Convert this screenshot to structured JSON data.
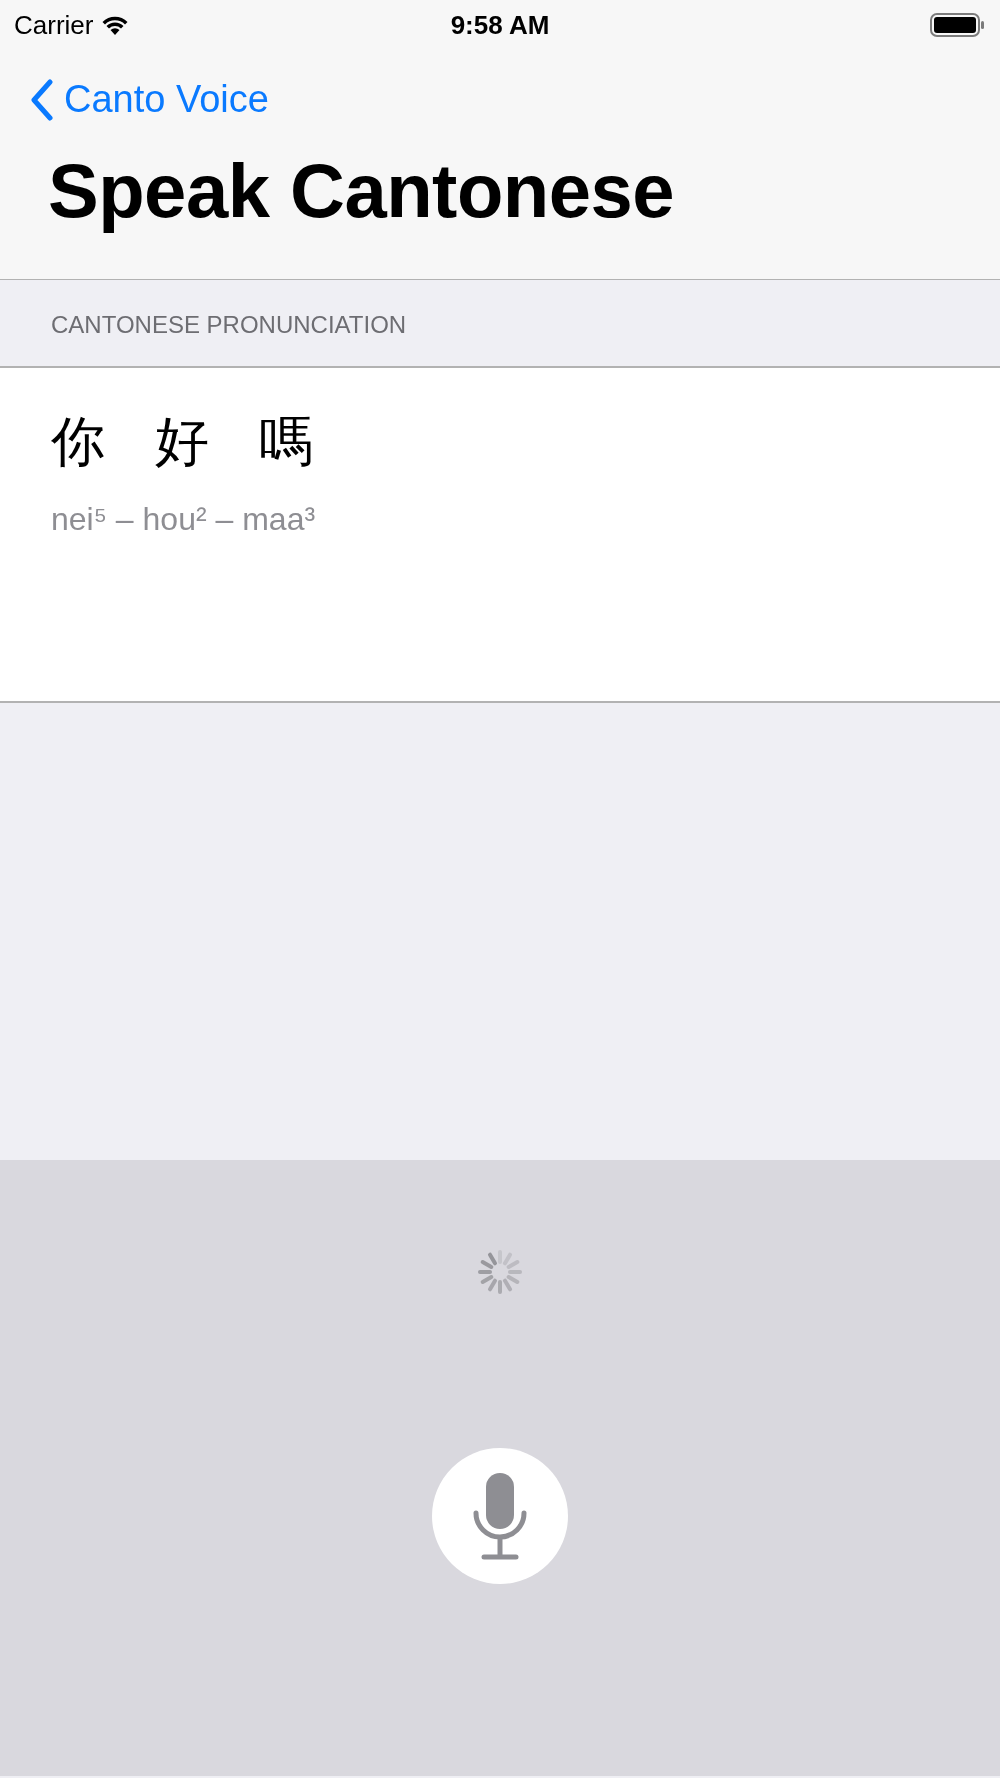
{
  "status_bar": {
    "carrier": "Carrier",
    "time": "9:58 AM"
  },
  "nav": {
    "back_label": "Canto Voice",
    "title": "Speak Cantonese"
  },
  "section": {
    "header": "CANTONESE PRONUNCIATION",
    "characters": [
      "你",
      "好",
      "嗎"
    ],
    "romanization": "nei⁵ – hou² – maa³"
  },
  "voice_panel": {
    "loading": true
  }
}
